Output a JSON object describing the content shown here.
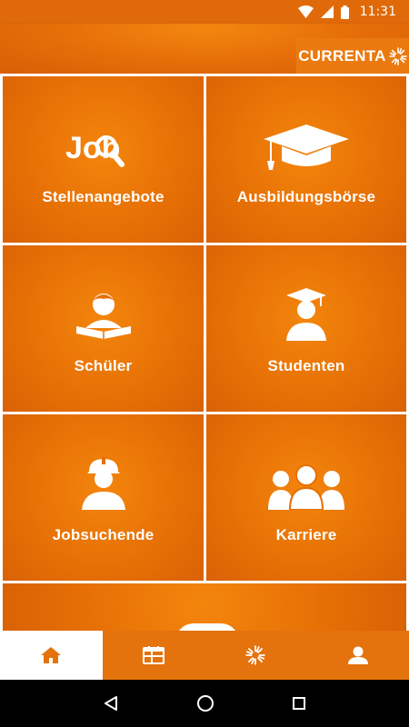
{
  "status_bar": {
    "time": "11:31"
  },
  "header": {
    "logo_text": "CURRENTA"
  },
  "tiles": [
    {
      "label": "Stellenangebote",
      "icon": "job-search-icon",
      "icon_text": "Job"
    },
    {
      "label": "Ausbildungsbörse",
      "icon": "graduation-cap-icon"
    },
    {
      "label": "Schüler",
      "icon": "student-reading-icon"
    },
    {
      "label": "Studenten",
      "icon": "graduate-person-icon"
    },
    {
      "label": "Jobsuchende",
      "icon": "worker-helmet-icon"
    },
    {
      "label": "Karriere",
      "icon": "group-people-icon"
    }
  ],
  "bottom_nav": [
    {
      "name": "home",
      "icon": "home-icon",
      "active": true
    },
    {
      "name": "calendar",
      "icon": "calendar-icon",
      "active": false
    },
    {
      "name": "currenta",
      "icon": "currenta-sun-icon",
      "active": false
    },
    {
      "name": "profile",
      "icon": "person-icon",
      "active": false
    }
  ],
  "colors": {
    "accent": "#e66f05",
    "accent_light": "#f3850c",
    "active_nav_icon": "#e4720d"
  }
}
